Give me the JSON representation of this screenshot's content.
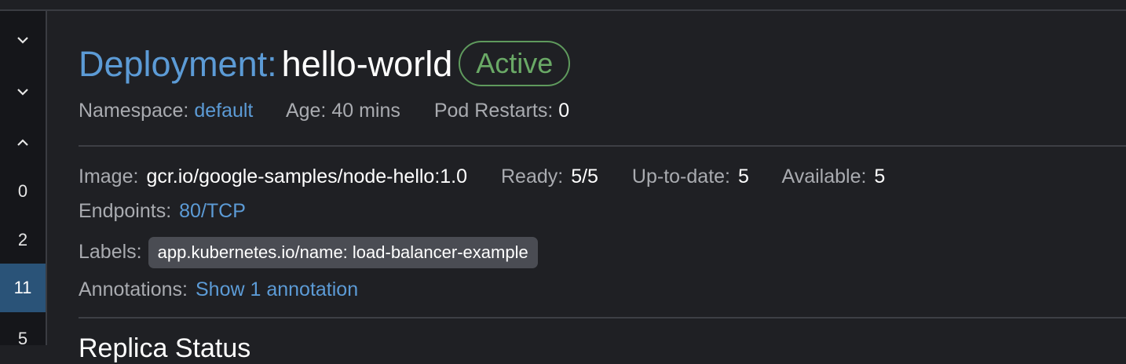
{
  "gutter": {
    "items": [
      {
        "type": "icon",
        "icon": "chevron-down-icon"
      },
      {
        "type": "icon",
        "icon": "chevron-down-icon"
      },
      {
        "type": "icon",
        "icon": "chevron-up-icon"
      },
      {
        "type": "number",
        "label": "0"
      },
      {
        "type": "number",
        "label": "2"
      },
      {
        "type": "number",
        "label": "11",
        "selected": true
      },
      {
        "type": "number",
        "label": "5"
      }
    ]
  },
  "header": {
    "prefix": "Deployment:",
    "name": "hello-world",
    "status": "Active"
  },
  "meta": {
    "namespace_label": "Namespace:",
    "namespace_value": "default",
    "age_label": "Age:",
    "age_value": "40 mins",
    "restarts_label": "Pod Restarts:",
    "restarts_value": "0"
  },
  "details": {
    "image_label": "Image:",
    "image_value": "gcr.io/google-samples/node-hello:1.0",
    "ready_label": "Ready:",
    "ready_value": "5/5",
    "uptodate_label": "Up-to-date:",
    "uptodate_value": "5",
    "available_label": "Available:",
    "available_value": "5",
    "endpoints_label": "Endpoints:",
    "endpoints_value": "80/TCP",
    "labels_label": "Labels:",
    "labels": [
      "app.kubernetes.io/name: load-balancer-example"
    ],
    "annotations_label": "Annotations:",
    "annotations_link": "Show 1 annotation"
  },
  "section": {
    "heading": "Replica Status"
  },
  "colors": {
    "accent_blue": "#5c9bd6",
    "status_green": "#6aa966",
    "selected_row": "#2a5378",
    "background": "#1f2024"
  }
}
